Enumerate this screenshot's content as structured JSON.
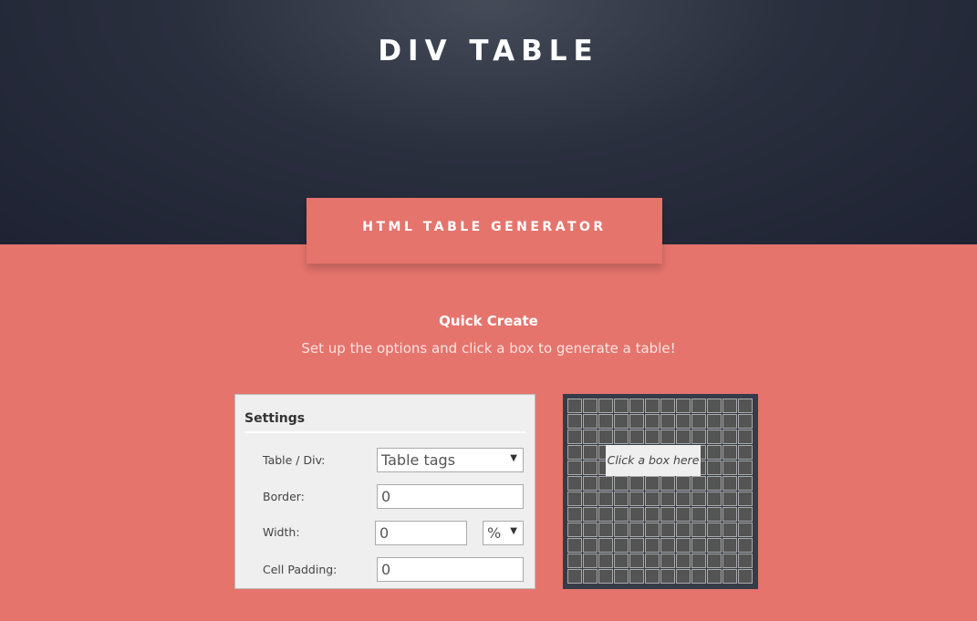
{
  "header": {
    "title": "DIV TABLE"
  },
  "tab": {
    "label": "HTML TABLE GENERATOR"
  },
  "quick_create": {
    "title": "Quick Create",
    "subtitle": "Set up the options and click a box to generate a table!"
  },
  "settings": {
    "title": "Settings",
    "table_div": {
      "label": "Table / Div:",
      "value": "Table tags"
    },
    "border": {
      "label": "Border:",
      "value": "0"
    },
    "width": {
      "label": "Width:",
      "value": "0",
      "unit": "%"
    },
    "cell_padding": {
      "label": "Cell Padding:",
      "value": "0"
    }
  },
  "grid": {
    "rows": 12,
    "cols": 12,
    "hint": "Click a box here"
  },
  "colors": {
    "header_bg": "#1e2232",
    "accent": "#e5746d",
    "grid_bg": "#363b48",
    "cell": "#545454"
  }
}
